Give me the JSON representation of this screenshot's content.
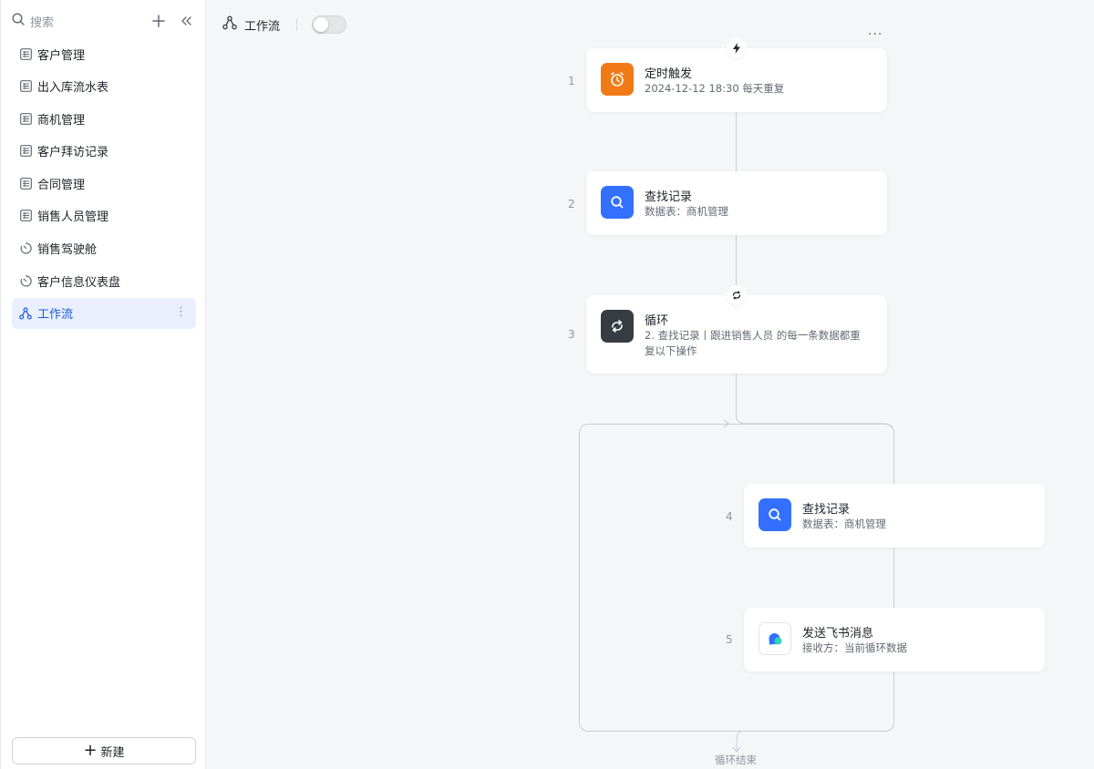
{
  "sidebar": {
    "search_label": "搜索",
    "items": [
      {
        "label": "客户管理",
        "icon": "table-icon"
      },
      {
        "label": "出入库流水表",
        "icon": "table-icon"
      },
      {
        "label": "商机管理",
        "icon": "table-icon"
      },
      {
        "label": "客户拜访记录",
        "icon": "table-icon"
      },
      {
        "label": "合同管理",
        "icon": "table-icon"
      },
      {
        "label": "销售人员管理",
        "icon": "table-icon"
      },
      {
        "label": "销售驾驶舱",
        "icon": "dashboard-icon"
      },
      {
        "label": "客户信息仪表盘",
        "icon": "dashboard-icon"
      },
      {
        "label": "工作流",
        "icon": "workflow-icon",
        "active": true
      }
    ],
    "more_label": "⋮",
    "new_label": "新建"
  },
  "header": {
    "title": "工作流",
    "toggle_on": false,
    "more_label": "···"
  },
  "nodes": [
    {
      "num": "1",
      "title": "定时触发",
      "subtitle": "2024-12-12 18:30 每天重复",
      "icon": "alarm-clock-icon",
      "color": "#f07b16"
    },
    {
      "num": "2",
      "title": "查找记录",
      "subtitle": "数据表：商机管理",
      "icon": "search-icon",
      "color": "#3370ff"
    },
    {
      "num": "3",
      "title": "循环",
      "subtitle": "2. 查找记录丨跟进销售人员 的每一条数据都重复以下操作",
      "icon": "loop-icon",
      "color": "#373c43"
    },
    {
      "num": "4",
      "title": "查找记录",
      "subtitle": "数据表：商机管理",
      "icon": "search-icon",
      "color": "#3370ff"
    },
    {
      "num": "5",
      "title": "发送飞书消息",
      "subtitle": "接收方：当前循环数据",
      "icon": "chat-bubble-icon",
      "color": "#ffffff"
    }
  ],
  "loop_end_label": "循环结束",
  "colors": {
    "accent": "#1c58d9",
    "active_bg": "#e9effd",
    "canvas": "#f5f6f7"
  }
}
